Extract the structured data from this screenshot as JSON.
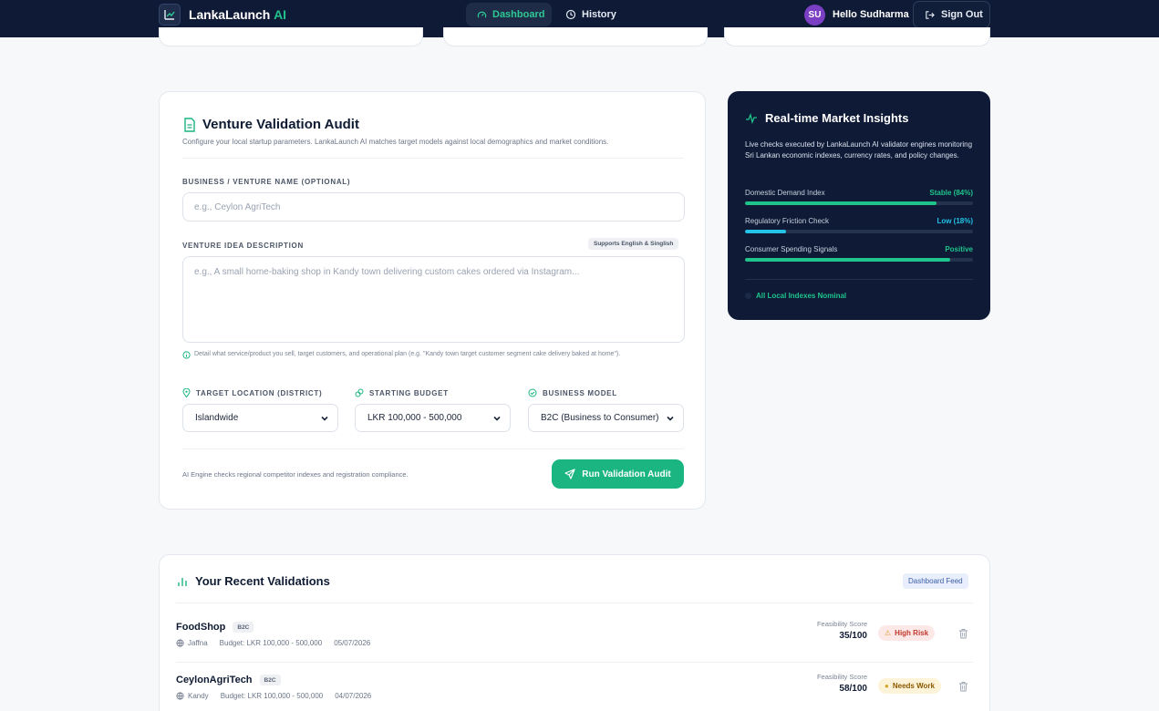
{
  "nav": {
    "brand_name": "LankaLaunch",
    "brand_ai": "AI",
    "tab_dashboard": "Dashboard",
    "tab_history": "History",
    "avatar_initials": "SU",
    "greeting": "Hello Sudharma",
    "sign_out": "Sign Out"
  },
  "audit": {
    "title": "Venture Validation Audit",
    "description": "Configure your local startup parameters. LankaLaunch AI matches target models against local demographics and market conditions.",
    "name_label": "BUSINESS / VENTURE NAME (OPTIONAL)",
    "name_placeholder": "e.g., Ceylon AgriTech",
    "idea_label": "VENTURE IDEA DESCRIPTION",
    "language_badge": "Supports English & Singlish",
    "idea_placeholder": "e.g., A small home-baking shop in Kandy town delivering custom cakes ordered via Instagram...",
    "idea_hint": "Detail what service/product you sell, target customers, and operational plan (e.g. \"Kandy town target customer segment cake delivery baked at home\").",
    "location_label": "TARGET LOCATION (DISTRICT)",
    "location_value": "Islandwide",
    "budget_label": "STARTING BUDGET",
    "budget_value": "LKR 100,000 - 500,000",
    "model_label": "BUSINESS MODEL",
    "model_value": "B2C (Business to Consumer)",
    "footnote": "AI Engine checks regional competitor indexes and registration compliance.",
    "run_button": "Run Validation Audit"
  },
  "insights": {
    "title": "Real-time Market Insights",
    "description": "Live checks executed by LankaLaunch AI validator engines monitoring Sri Lankan economic indexes, currency rates, and policy changes.",
    "metrics": [
      {
        "name": "Domestic Demand Index",
        "value": "Stable (84%)",
        "level": 0.84,
        "color": "#1fc48b"
      },
      {
        "name": "Regulatory Friction Check",
        "value": "Low (18%)",
        "level": 0.18,
        "color": "#22c3e6"
      },
      {
        "name": "Consumer Spending Signals",
        "value": "Positive",
        "level": 0.9,
        "color": "#1fc48b"
      }
    ],
    "status": "All Local Indexes Nominal"
  },
  "recent": {
    "title": "Your Recent Validations",
    "feed_badge": "Dashboard Feed",
    "score_label": "Feasibility Score",
    "items": [
      {
        "name": "FoodShop",
        "model": "B2C",
        "location": "Jaffna",
        "budget": "Budget: LKR 100,000 - 500,000",
        "date": "05/07/2026",
        "score": "35/100",
        "risk": "High Risk"
      },
      {
        "name": "CeylonAgriTech",
        "model": "B2C",
        "location": "Kandy",
        "budget": "Budget: LKR 100,000 - 500,000",
        "date": "04/07/2026",
        "score": "58/100",
        "risk": "Needs Work"
      }
    ]
  },
  "colors": {
    "navy": "#0e1a36",
    "accent_green": "#1ab580",
    "high_risk": "#c0392b",
    "needs_work": "#8a5a00"
  }
}
